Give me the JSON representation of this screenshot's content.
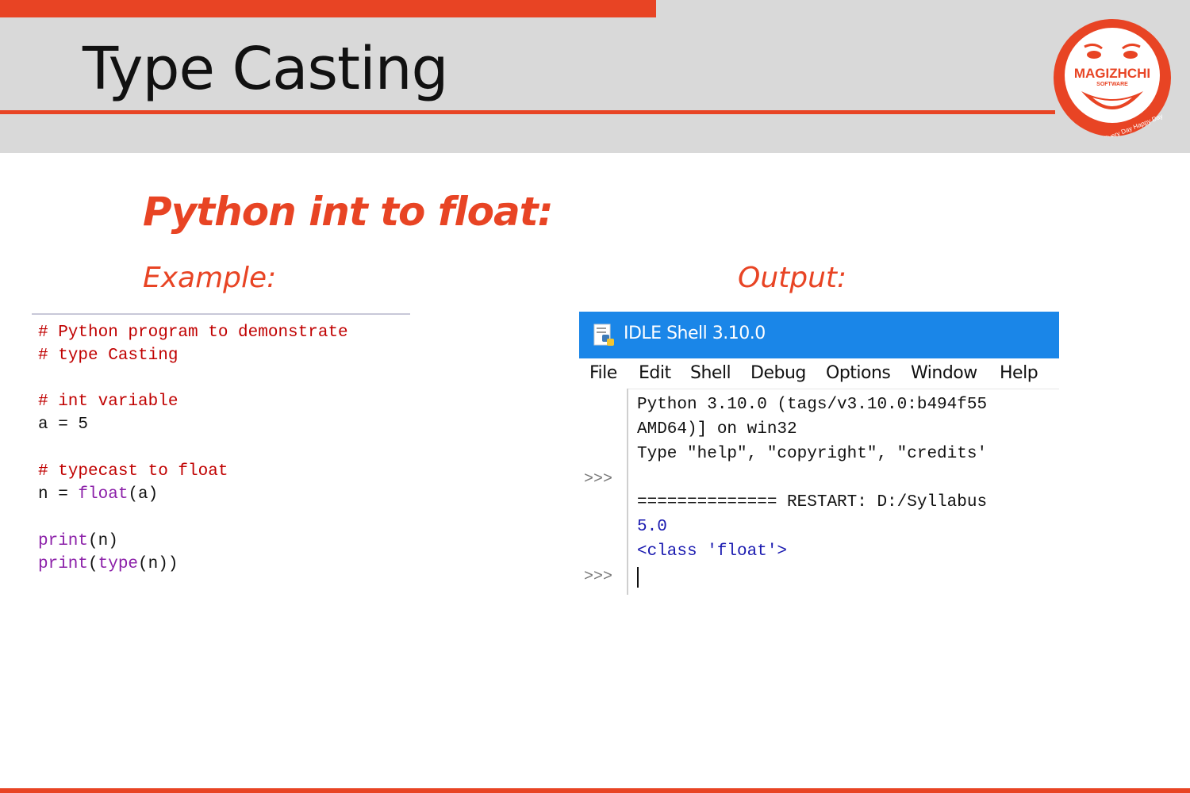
{
  "slide": {
    "title": "Type Casting",
    "heading": "Python int to float:",
    "example_label": "Example:",
    "output_label": "Output:"
  },
  "logo": {
    "brand": "MAGIZHCHI",
    "sub": "SOFTWARE",
    "tagline": "Every Day Happy Day"
  },
  "code": {
    "lines": [
      "# Python program to demonstrate",
      "# type Casting",
      "# int variable",
      "a = 5",
      "# typecast to float",
      "print(n)"
    ],
    "assign_var": "n = ",
    "assign_func": "float",
    "assign_arg": "(a)",
    "print_func": "print",
    "print_arg_open": "(",
    "print_inner": "type",
    "print_arg_close": "(n))",
    "print_first_func": "print",
    "print_first_arg": "(n)"
  },
  "shell": {
    "title": "IDLE Shell 3.10.0",
    "menu": [
      "File",
      "Edit",
      "Shell",
      "Debug",
      "Options",
      "Window",
      "Help"
    ],
    "prompt": ">>>",
    "lines": [
      "Python 3.10.0 (tags/v3.10.0:b494f55",
      "AMD64)] on win32",
      "Type \"help\", \"copyright\", \"credits'",
      "============== RESTART: D:/Syllabus"
    ],
    "outputs": [
      "5.0",
      "<class 'float'>"
    ]
  },
  "colors": {
    "accent": "#e84424",
    "header_band": "#d9d9d9",
    "titlebar": "#1a86e8"
  }
}
